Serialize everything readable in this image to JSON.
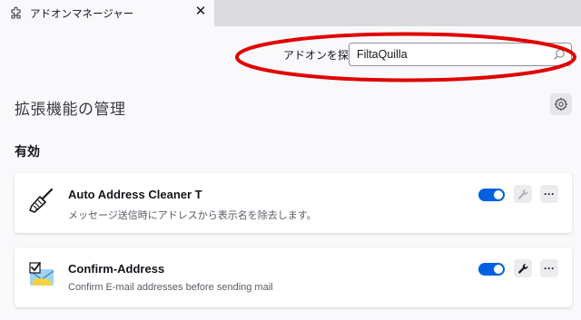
{
  "tab": {
    "title": "アドオンマネージャー",
    "close_glyph": "✕"
  },
  "search": {
    "label": "アドオンを探す",
    "value": "FiltaQuilla"
  },
  "page": {
    "title": "拡張機能の管理",
    "section_heading": "有効"
  },
  "addons": [
    {
      "name": "Auto Address Cleaner T",
      "description": "メッセージ送信時にアドレスから表示名を除去します。",
      "enabled": true,
      "icon": "broom-icon"
    },
    {
      "name": "Confirm-Address",
      "description": "Confirm E-mail addresses before sending mail",
      "enabled": true,
      "icon": "confirm-address-icon"
    }
  ],
  "more_glyph": "···",
  "colors": {
    "accent": "#0061e0",
    "annotation": "#e00000",
    "background": "#f9f9fb"
  }
}
